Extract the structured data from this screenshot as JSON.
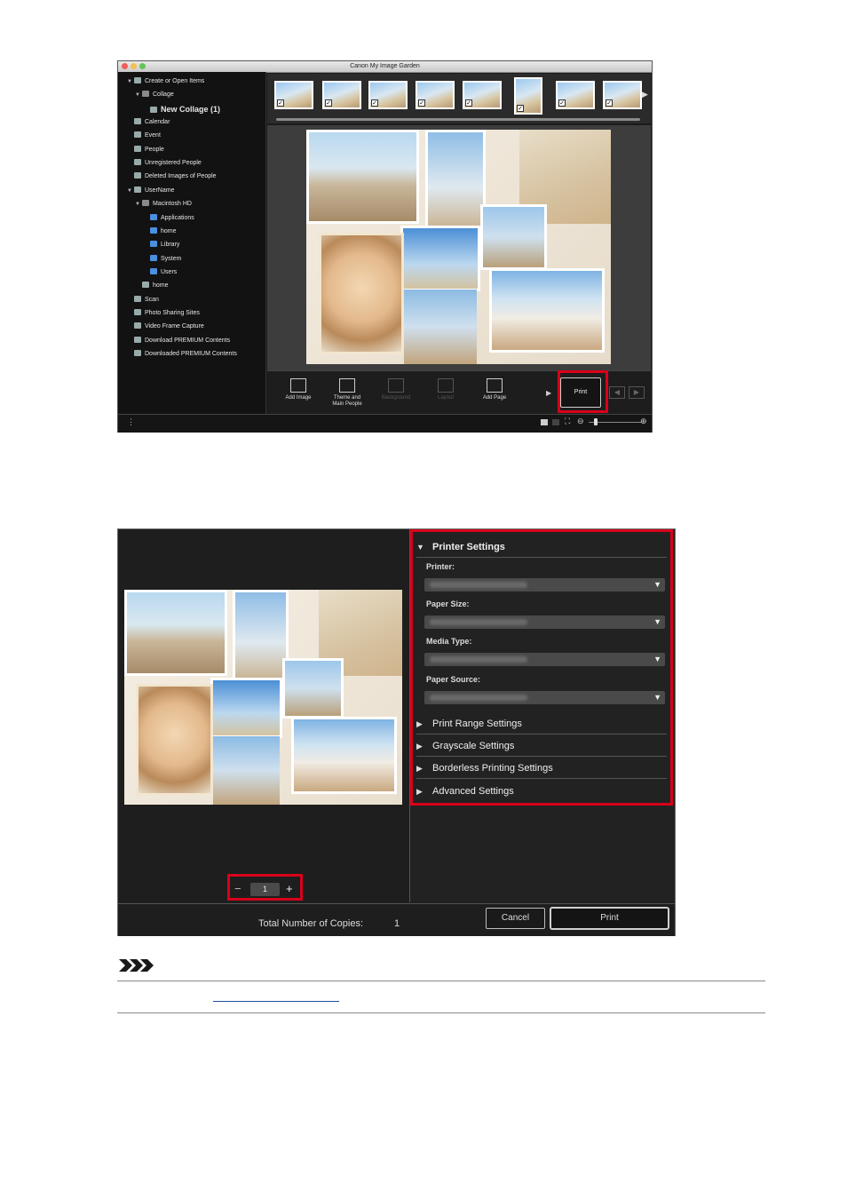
{
  "window1": {
    "title": "Canon My Image Garden",
    "sidebar_items": [
      {
        "label": "Create or Open Items",
        "level": 0,
        "expanded": true
      },
      {
        "label": "Collage",
        "level": 1,
        "expanded": true
      },
      {
        "label": "New Collage (1)",
        "level": 2,
        "selected": true
      },
      {
        "label": "Calendar",
        "level": 0
      },
      {
        "label": "Event",
        "level": 0
      },
      {
        "label": "People",
        "level": 0
      },
      {
        "label": "Unregistered People",
        "level": 0
      },
      {
        "label": "Deleted Images of People",
        "level": 0
      },
      {
        "label": "UserName",
        "level": 0,
        "expanded": true
      },
      {
        "label": "Macintosh HD",
        "level": 1,
        "expanded": true
      },
      {
        "label": "Applications",
        "level": 2
      },
      {
        "label": "home",
        "level": 2
      },
      {
        "label": "Library",
        "level": 2
      },
      {
        "label": "System",
        "level": 2
      },
      {
        "label": "Users",
        "level": 2
      },
      {
        "label": "home",
        "level": 1
      },
      {
        "label": "Scan",
        "level": 0
      },
      {
        "label": "Photo Sharing Sites",
        "level": 0
      },
      {
        "label": "Video Frame Capture",
        "level": 0
      },
      {
        "label": "Download PREMIUM Contents",
        "level": 0
      },
      {
        "label": "Downloaded PREMIUM Contents",
        "level": 0
      }
    ],
    "toolbar": {
      "add_image": "Add Image",
      "theme_line1": "Theme and",
      "theme_line2": "Main People",
      "background": "Background",
      "layout": "Layout",
      "add_page": "Add Page",
      "print": "Print"
    }
  },
  "dialog": {
    "printer_settings": "Printer Settings",
    "printer_label": "Printer:",
    "paper_size_label": "Paper Size:",
    "media_type_label": "Media Type:",
    "paper_source_label": "Paper Source:",
    "print_range_settings": "Print Range Settings",
    "grayscale_settings": "Grayscale Settings",
    "borderless_settings": "Borderless Printing Settings",
    "advanced_settings": "Advanced Settings",
    "copies_value": "1",
    "minus": "−",
    "plus": "+",
    "total_label": "Total Number of Copies:",
    "total_value": "1",
    "cancel": "Cancel",
    "print": "Print"
  },
  "colors": {
    "highlight": "#d9001b",
    "panel_dark": "#1e1e1e"
  }
}
